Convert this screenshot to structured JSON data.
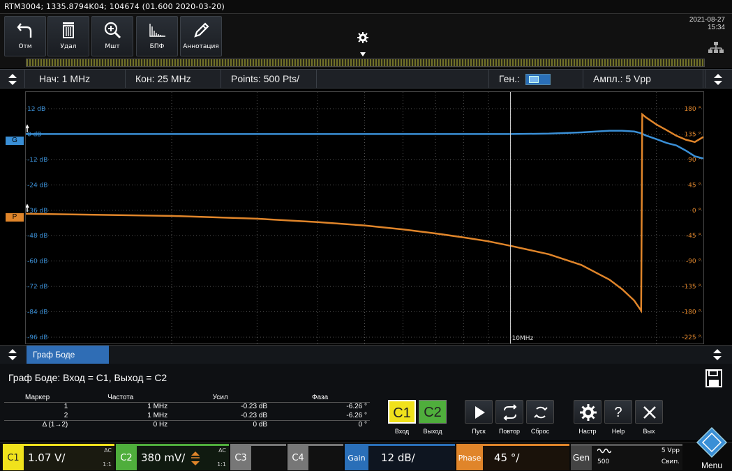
{
  "title_bar": "RTM3004; 1335.8794K04; 104674 (01.600 2020-03-20)",
  "toolbar": {
    "buttons": [
      {
        "label": "Отм",
        "icon": "undo-icon"
      },
      {
        "label": "Удал",
        "icon": "trash-icon"
      },
      {
        "label": "Мшт",
        "icon": "zoom-icon"
      },
      {
        "label": "БПФ",
        "icon": "fft-icon"
      },
      {
        "label": "Аннотация",
        "icon": "pen-icon"
      }
    ],
    "date": "2021-08-27",
    "time": "15:34"
  },
  "settings": {
    "start": "Нач: 1 MHz",
    "stop": "Кон: 25 MHz",
    "points": "Points: 500 Pts/",
    "gen_label": "Ген.:",
    "gen_on": true,
    "amplitude": "Ампл.: 5 Vpp"
  },
  "plot": {
    "left_markers": [
      "G",
      "P"
    ],
    "marker_label": "10MHz",
    "colors": {
      "gain": "#3a8fd6",
      "phase": "#e0852a",
      "grid": "#555"
    }
  },
  "chart_data": {
    "type": "line",
    "title": "",
    "xlabel": "",
    "x_scale": "log",
    "xlim": [
      1,
      25
    ],
    "x_unit": "MHz",
    "left_axis": {
      "ticks": [
        "12 dB",
        "0 dB",
        "-12 dB",
        "-24 dB",
        "-36 dB",
        "-48 dB",
        "-60 dB",
        "-72 dB",
        "-84 dB",
        "-96 dB"
      ],
      "ylim": [
        -96,
        12
      ]
    },
    "right_axis": {
      "ticks": [
        "180 °",
        "135 °",
        "90 °",
        "45 °",
        "0 °",
        "-45 °",
        "-90 °",
        "-135 °",
        "-180 °",
        "-225 °"
      ],
      "ylim": [
        -225,
        180
      ]
    },
    "series": [
      {
        "axis": "left",
        "x": [
          1,
          2,
          3,
          4,
          5,
          6,
          7,
          8,
          9,
          10,
          12,
          14,
          16,
          17,
          18,
          18.6,
          19,
          20,
          21,
          22,
          23,
          24,
          25
        ],
        "y": [
          0,
          0,
          0,
          0,
          0,
          0,
          0,
          0,
          0,
          0,
          0.2,
          0.8,
          1.6,
          1.6,
          1.2,
          0.4,
          -0.6,
          -2.4,
          -4.2,
          -5.4,
          -7.8,
          -10.5,
          -11.5
        ]
      },
      {
        "axis": "right",
        "x": [
          1,
          2,
          3,
          4,
          5,
          6,
          7,
          8,
          9,
          10,
          12,
          14,
          16,
          17,
          18,
          18.6,
          18.7,
          19,
          20,
          21,
          22,
          23,
          24,
          25
        ],
        "y": [
          -6.26,
          -10,
          -15,
          -21,
          -27,
          -34,
          -41,
          -48,
          -55,
          -63,
          -78,
          -97,
          -123,
          -140,
          -160,
          -178,
          170,
          165,
          152,
          142,
          132,
          125,
          121,
          130
        ]
      }
    ]
  },
  "mode_tab": "Граф Боде",
  "info": {
    "title": "Граф Боде: Вход = C1, Выход = C2",
    "marker_table": {
      "headers": [
        "Маркер",
        "Частота",
        "Усил",
        "Фаза"
      ],
      "rows": [
        [
          "1",
          "1 MHz",
          "-0.23 dB",
          "-6.26 °"
        ],
        [
          "2",
          "1 MHz",
          "-0.23 dB",
          "-6.26 °"
        ],
        [
          "Δ (1→2)",
          "0 Hz",
          "0 dB",
          "0 °"
        ]
      ]
    },
    "in_out": {
      "c1": "C1",
      "c2": "C2",
      "in_label": "Вход",
      "out_label": "Выход"
    },
    "controls": [
      "Пуск",
      "Повтор",
      "Сброс"
    ],
    "right_controls": [
      "Настр",
      "Help",
      "Вых"
    ],
    "help_glyph": "?"
  },
  "status": {
    "c1": {
      "name": "C1",
      "value": "1.07 V/",
      "coupling": "AC",
      "probe": "1:1"
    },
    "c2": {
      "name": "C2",
      "value": "380 mV/",
      "coupling": "AC",
      "probe": "1:1"
    },
    "c3": {
      "name": "C3"
    },
    "c4": {
      "name": "C4"
    },
    "gain": {
      "name": "Gain",
      "value": "12 dB/"
    },
    "phase": {
      "name": "Phase",
      "value": "45 °/"
    },
    "gen": {
      "name": "Gen",
      "count": "500",
      "amp": "5 Vpp",
      "mode": "Свип."
    },
    "menu": "Menu"
  }
}
